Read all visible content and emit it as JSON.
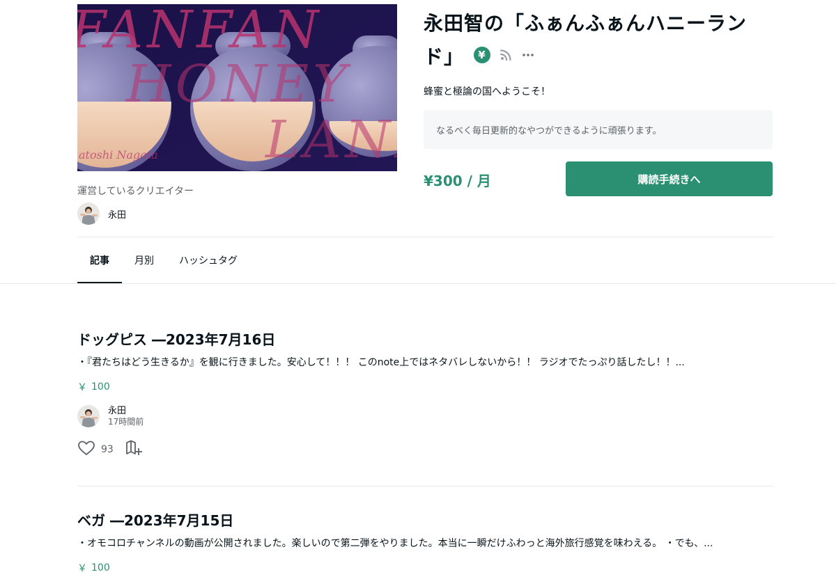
{
  "magazine": {
    "title": "永田智の「ふぁんふぁんハニーランド」",
    "tagline": "蜂蜜と極論の国へようこそ！",
    "description": "なるべく毎日更新的なやつができるように頑張ります。",
    "price": "¥300 / 月",
    "subscribe_label": "購読手続きへ",
    "icons": [
      "yen-icon",
      "rss-icon",
      "more-icon"
    ],
    "cover_text": [
      "FANFAN",
      "HONEY",
      "LAND",
      "atoshi Nagata"
    ]
  },
  "creator": {
    "label": "運営しているクリエイター",
    "name": "永田"
  },
  "tabs": [
    {
      "label": "記事",
      "active": true
    },
    {
      "label": "月別",
      "active": false
    },
    {
      "label": "ハッシュタグ",
      "active": false
    }
  ],
  "articles": [
    {
      "title": "ドッグピス ―2023年7月16日",
      "excerpt": "・『君たちはどう生きるか』を観に行きました。安心して！！！ このnote上ではネタバレしないから！！ ラジオでたっぷり話したし！！...",
      "price_symbol": "￥",
      "price": "100",
      "author": "永田",
      "time": "17時間前",
      "likes": "93"
    },
    {
      "title": "ベガ ―2023年7月15日",
      "excerpt": "・オモコロチャンネルの動画が公開されました。楽しいので第二弾をやりました。本当に一瞬だけふわっと海外旅行感覚を味わえる。 ・でも、...",
      "price_symbol": "￥",
      "price": "100"
    }
  ],
  "colors": {
    "accent": "#2a9071",
    "text": "#08131a",
    "muted": "#5c6166",
    "divider": "#e6e8e9"
  }
}
